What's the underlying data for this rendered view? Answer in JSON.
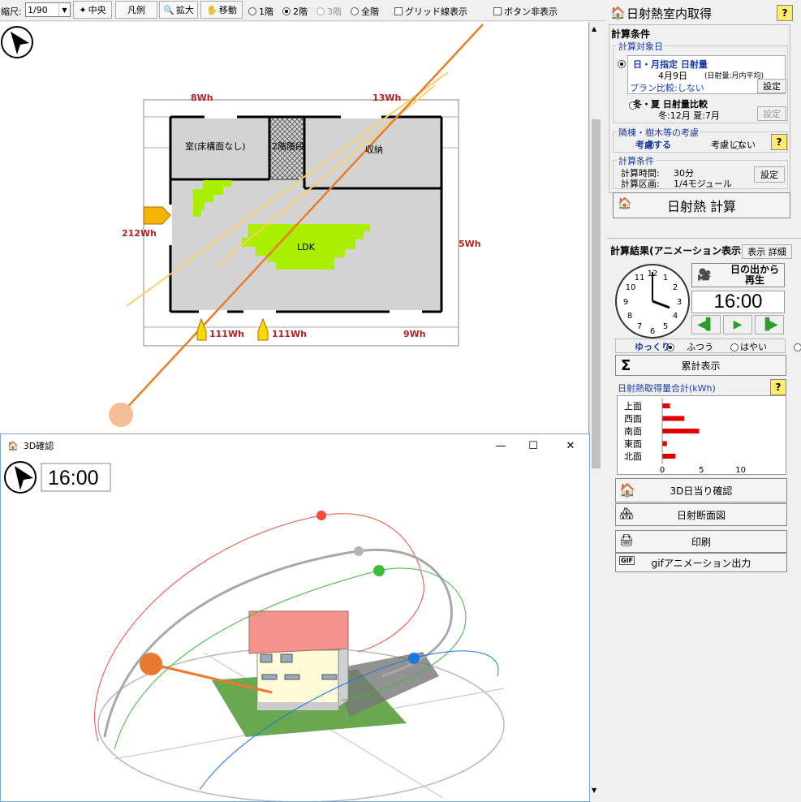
{
  "toolbar": {
    "scale_label": "縮尺:",
    "scale_value": "1/90",
    "center_btn": "中央",
    "legend_btn": "凡例",
    "zoom_btn": "拡大",
    "move_btn": "移動",
    "floors": [
      {
        "label": "1階",
        "selected": false,
        "disabled": false
      },
      {
        "label": "2階",
        "selected": true,
        "disabled": false
      },
      {
        "label": "3階",
        "selected": false,
        "disabled": true
      },
      {
        "label": "全階",
        "selected": false,
        "disabled": false
      }
    ],
    "grid_label": "グリッド線表示",
    "hide_buttons_label": "ボタン非表示"
  },
  "plan": {
    "rooms": {
      "room1": "室(床構面なし)",
      "stairs": "2階階段",
      "closet": "収納",
      "ldk": "LDK"
    },
    "wh_labels": {
      "north_left": "8Wh",
      "north_right": "13Wh",
      "west": "212Wh",
      "east": "5Wh",
      "south1": "111Wh",
      "south2": "111Wh",
      "south3": "9Wh"
    }
  },
  "panel": {
    "title": "日射熱室内取得",
    "help": "?",
    "calc_conditions": "計算条件",
    "target_day_group": "計算対象日",
    "opt1_title": "日・月指定 日射量",
    "opt1_detail": "4月9日",
    "opt1_note": "(日射量:月内平均)",
    "plan_compare": "プラン比較:しない",
    "set_btn": "設定",
    "opt2_title": "冬・夏 日射量比較",
    "opt2_detail": "冬:12月 夏:7月",
    "neighbors_group": "隣棟・樹木等の考慮",
    "consider_on": "考慮する",
    "consider_off": "考慮しない",
    "cond_group": "計算条件",
    "calc_time": "計算時間:",
    "calc_time_val": "30分",
    "calc_area": "計算区画:",
    "calc_area_val": "1/4モジュール",
    "calc_btn": "日射熱 計算",
    "results_title": "計算結果(アニメーション表示)",
    "display_detail_btn": "表示 詳細",
    "replay_btn_line1": "日の出から",
    "replay_btn_line2": "再生",
    "time": "16:00",
    "speed": [
      {
        "label": "ゆっくり",
        "selected": true
      },
      {
        "label": "ふつう",
        "selected": false
      },
      {
        "label": "はやい",
        "selected": false
      }
    ],
    "cumulative_btn": "累計表示",
    "chart_title": "日射熱取得量合計(kWh)",
    "btn_3d": "3D日当り確認",
    "btn_section": "日射断面図",
    "btn_print": "印刷",
    "btn_gif": "gifアニメーション出力"
  },
  "chart_data": {
    "type": "bar",
    "orientation": "horizontal",
    "categories": [
      "上面",
      "西面",
      "南面",
      "東面",
      "北面"
    ],
    "values": [
      1.0,
      2.8,
      4.7,
      0.6,
      1.7
    ],
    "xlim": [
      0,
      15
    ],
    "xticks": [
      "0",
      "5",
      "10"
    ],
    "color": "#e00000"
  },
  "win3d": {
    "title": "3D確認",
    "time": "16:00",
    "minimize": "—",
    "maximize": "☐",
    "close": "✕"
  }
}
